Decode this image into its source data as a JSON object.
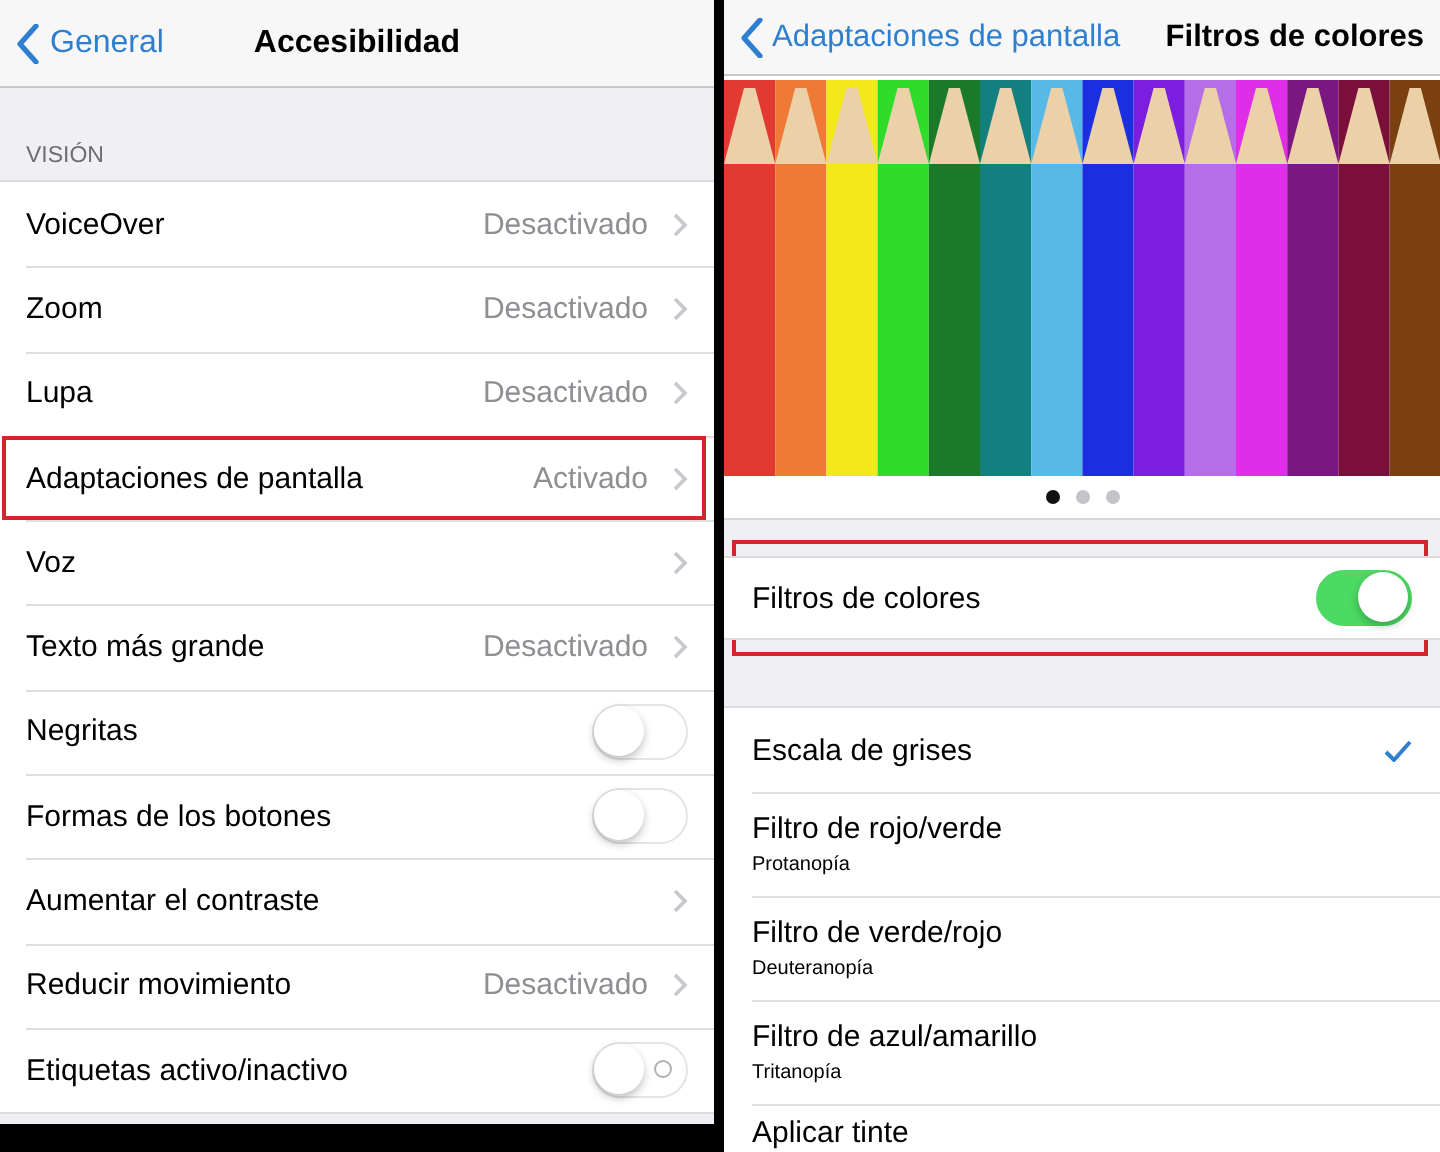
{
  "left_screen": {
    "nav": {
      "back": "General",
      "title": "Accesibilidad"
    },
    "section_header": "VISIÓN",
    "rows": [
      {
        "kind": "link",
        "label": "VoiceOver",
        "value": "Desactivado",
        "highlighted": false
      },
      {
        "kind": "link",
        "label": "Zoom",
        "value": "Desactivado",
        "highlighted": false
      },
      {
        "kind": "link",
        "label": "Lupa",
        "value": "Desactivado",
        "highlighted": false
      },
      {
        "kind": "link",
        "label": "Adaptaciones de pantalla",
        "value": "Activado",
        "highlighted": true
      },
      {
        "kind": "link",
        "label": "Voz",
        "highlighted": false
      },
      {
        "kind": "link",
        "label": "Texto más grande",
        "value": "Desactivado",
        "highlighted": false
      },
      {
        "kind": "toggle",
        "label": "Negritas",
        "on": false,
        "highlighted": false
      },
      {
        "kind": "toggle",
        "label": "Formas de los botones",
        "on": false,
        "highlighted": false
      },
      {
        "kind": "link",
        "label": "Aumentar el contraste",
        "highlighted": false
      },
      {
        "kind": "link",
        "label": "Reducir movimiento",
        "value": "Desactivado",
        "highlighted": false
      },
      {
        "kind": "toggle",
        "label": "Etiquetas activo/inactivo",
        "on": false,
        "labels": true,
        "highlighted": false
      }
    ]
  },
  "right_screen": {
    "nav": {
      "back": "Adaptaciones de pantalla",
      "title": "Filtros de colores"
    },
    "page_dots": [
      {
        "selected": true
      },
      {
        "selected": false
      },
      {
        "selected": false
      }
    ],
    "toggle_row": {
      "label": "Filtros de colores",
      "on": true,
      "highlighted": true
    },
    "filters": [
      {
        "label": "Escala de grises",
        "selected": true
      },
      {
        "label": "Filtro de rojo/verde",
        "sublabel": "Protanopía",
        "selected": false
      },
      {
        "label": "Filtro de verde/rojo",
        "sublabel": "Deuteranopía",
        "selected": false
      },
      {
        "label": "Filtro de azul/amarillo",
        "sublabel": "Tritanopía",
        "selected": false
      },
      {
        "label": "Aplicar tinte",
        "selected": false
      }
    ]
  }
}
